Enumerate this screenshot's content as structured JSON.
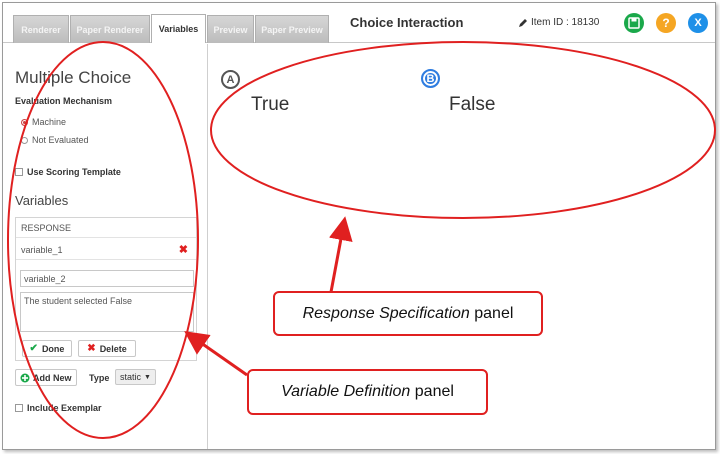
{
  "tabs": [
    {
      "label": "Renderer",
      "active": false
    },
    {
      "label": "Paper Renderer",
      "active": false
    },
    {
      "label": "Variables",
      "active": true
    },
    {
      "label": "Preview",
      "active": false
    },
    {
      "label": "Paper Preview",
      "active": false
    }
  ],
  "header": {
    "title": "Choice Interaction",
    "item_id": "Item ID : 18130",
    "save_icon": "save-icon",
    "help_icon": "help-icon",
    "close_icon": "close-icon",
    "help_glyph": "?",
    "close_glyph": "X"
  },
  "sidebar": {
    "title": "Multiple Choice",
    "evaluation_label": "Evaluation Mechanism",
    "radio_options": [
      {
        "label": "Machine",
        "selected": true
      },
      {
        "label": "Not Evaluated",
        "selected": false
      }
    ],
    "scoring_template_label": "Use Scoring Template",
    "variables_heading": "Variables",
    "response_label": "RESPONSE",
    "variable_1": "variable_1",
    "variable_2_value": "variable_2",
    "description_value": "The student selected False",
    "done_label": "Done",
    "delete_label": "Delete",
    "add_new_label": "Add New",
    "type_label": "Type",
    "type_value": "static",
    "include_exemplar_label": "Include Exemplar"
  },
  "main": {
    "choices": [
      {
        "letter": "A",
        "text": "True",
        "selected": false
      },
      {
        "letter": "B",
        "text": "False",
        "selected": true
      }
    ]
  },
  "annotations": {
    "response_callout_italic": "Response Specification",
    "response_callout_rest": " panel",
    "variable_callout_italic": "Variable Definition",
    "variable_callout_rest": " panel"
  },
  "colors": {
    "annotation_red": "#e02020",
    "save_green": "#1aa84a",
    "help_orange": "#f5a623",
    "close_blue": "#1e90e8",
    "choice_blue": "#2f7de0"
  }
}
